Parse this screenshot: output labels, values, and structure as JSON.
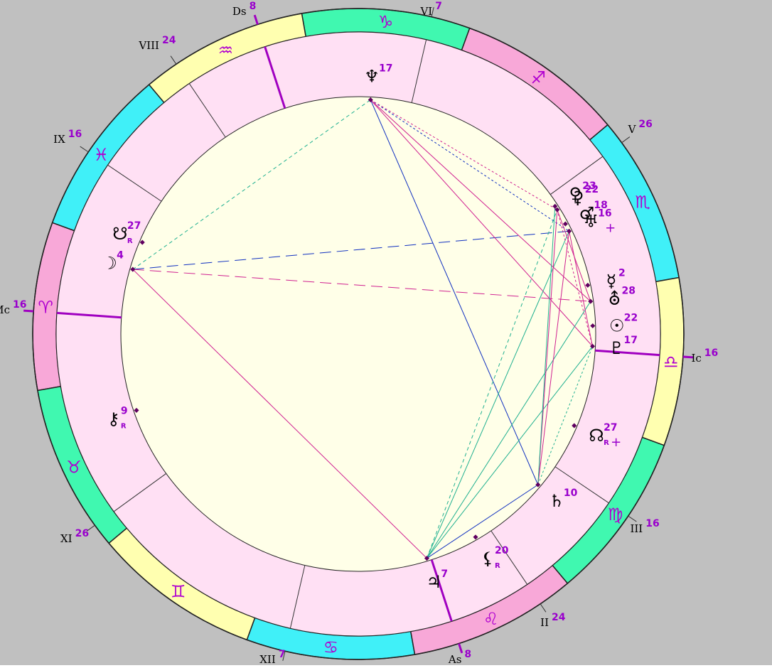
{
  "colors": {
    "background": "#c0c0c0",
    "inner_disc": "#ffffe8",
    "house_band": "#ffe0f4",
    "fire": "#f8a8d8",
    "earth": "#40f8b0",
    "air": "#ffffb0",
    "water": "#40f0f8",
    "sign_glyph": "#b000d0",
    "degree": "#9900cc"
  },
  "signs": [
    {
      "name": "Aries",
      "glyph": "♈",
      "element": "fire"
    },
    {
      "name": "Taurus",
      "glyph": "♉",
      "element": "earth"
    },
    {
      "name": "Gemini",
      "glyph": "♊",
      "element": "air"
    },
    {
      "name": "Cancer",
      "glyph": "♋",
      "element": "water"
    },
    {
      "name": "Leo",
      "glyph": "♌",
      "element": "fire"
    },
    {
      "name": "Virgo",
      "glyph": "♍",
      "element": "earth"
    },
    {
      "name": "Libra",
      "glyph": "♎",
      "element": "air"
    },
    {
      "name": "Scorpio",
      "glyph": "♏",
      "element": "water"
    },
    {
      "name": "Sagittarius",
      "glyph": "♐",
      "element": "fire"
    },
    {
      "name": "Capricorn",
      "glyph": "♑",
      "element": "earth"
    },
    {
      "name": "Aquarius",
      "glyph": "♒",
      "element": "air"
    },
    {
      "name": "Pisces",
      "glyph": "♓",
      "element": "water"
    }
  ],
  "houses": [
    {
      "label": "As",
      "degree": "8",
      "lon": 128
    },
    {
      "label": "II",
      "degree": "24",
      "lon": 144
    },
    {
      "label": "III",
      "degree": "16",
      "lon": 166
    },
    {
      "label": "Ic",
      "degree": "16",
      "lon": 196
    },
    {
      "label": "V",
      "degree": "26",
      "lon": 236
    },
    {
      "label": "VI",
      "degree": "7",
      "lon": 277
    },
    {
      "label": "Ds",
      "degree": "8",
      "lon": 308
    },
    {
      "label": "VIII",
      "degree": "24",
      "lon": 324
    },
    {
      "label": "IX",
      "degree": "16",
      "lon": 346
    },
    {
      "label": "Mc",
      "degree": "16",
      "lon": 16
    },
    {
      "label": "XI",
      "degree": "26",
      "lon": 56
    },
    {
      "label": "XII",
      "degree": "7",
      "lon": 97
    }
  ],
  "planets": [
    {
      "key": "neptune",
      "glyph": "♆",
      "degree": "17",
      "lon": 287
    },
    {
      "key": "venus",
      "glyph": "♀",
      "degree": "23",
      "lon": 233
    },
    {
      "key": "ceres",
      "glyph": "⚳",
      "degree": "22",
      "lon": 232
    },
    {
      "key": "mars",
      "glyph": "♂",
      "degree": "18",
      "lon": 228
    },
    {
      "key": "eros",
      "glyph": "♅",
      "degree": "16",
      "lon": 226,
      "marker": "+"
    },
    {
      "key": "mercury",
      "glyph": "☿",
      "degree": "2",
      "lon": 212
    },
    {
      "key": "sun",
      "glyph": "☉",
      "degree": "22",
      "lon": 202
    },
    {
      "key": "uranus",
      "glyph": "⛢",
      "degree": "28",
      "lon": 208
    },
    {
      "key": "pluto",
      "glyph": "♇",
      "degree": "17",
      "lon": 197
    },
    {
      "key": "north-node",
      "glyph": "☊",
      "degree": "27",
      "lon": 177,
      "retro": "R",
      "marker": "+"
    },
    {
      "key": "saturn",
      "glyph": "♄",
      "degree": "10",
      "lon": 160
    },
    {
      "key": "lilith",
      "glyph": "⚸",
      "degree": "20",
      "lon": 140,
      "retro": "R"
    },
    {
      "key": "jupiter",
      "glyph": "♃",
      "degree": "7",
      "lon": 127
    },
    {
      "key": "chiron",
      "glyph": "⚷",
      "degree": "9",
      "lon": 39,
      "retro": "R"
    },
    {
      "key": "moon",
      "glyph": "☽",
      "degree": "4",
      "lon": 4
    },
    {
      "key": "south-node",
      "glyph": "☋",
      "degree": "27",
      "lon": 357,
      "retro": "R"
    }
  ],
  "retro_label": "R"
}
